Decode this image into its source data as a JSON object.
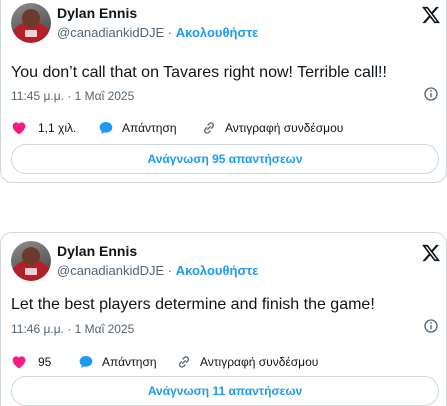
{
  "tweets": [
    {
      "author": {
        "name": "Dylan Ennis",
        "handle": "@canadiankidDJE",
        "separator": "·",
        "follow_label": "Ακολουθήστε"
      },
      "text": "You don’t call that on Tavares right now! Terrible call!!",
      "timestamp": "11:45 μ.μ. · 1 Μαΐ 2025",
      "likes": "1,1 χιλ.",
      "reply_label": "Απάντηση",
      "copy_link_label": "Αντιγραφή συνδέσμου",
      "read_replies_label": "Ανάγνωση 95 απαντήσεων"
    },
    {
      "author": {
        "name": "Dylan Ennis",
        "handle": "@canadiankidDJE",
        "separator": "·",
        "follow_label": "Ακολουθήστε"
      },
      "text": "Let the best players determine and finish the game!",
      "timestamp": "11:46 μ.μ. · 1 Μαΐ 2025",
      "likes": "95",
      "reply_label": "Απάντηση",
      "copy_link_label": "Αντιγραφή συνδέσμου",
      "read_replies_label": "Ανάγνωση 11 απαντήσεων"
    }
  ],
  "icons": {
    "logo": "x-logo-icon",
    "info": "info-icon",
    "like": "heart-icon",
    "reply": "speech-bubble-icon",
    "copy_link": "link-icon"
  },
  "colors": {
    "accent": "#1d9bf0",
    "like": "#f91880",
    "text": "#0f1419",
    "secondary": "#536471",
    "border": "#cfd9de"
  }
}
